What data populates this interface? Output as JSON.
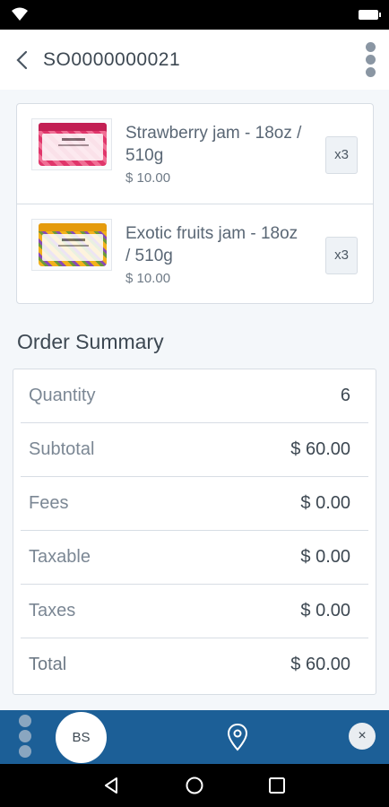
{
  "header": {
    "title": "SO0000000021"
  },
  "order_lines": [
    {
      "name": "Strawberry jam - 18oz / 510g",
      "price": "$ 10.00",
      "quantity": "x3"
    },
    {
      "name": "Exotic fruits jam - 18oz / 510g",
      "price": "$ 10.00",
      "quantity": "x3"
    }
  ],
  "summary": {
    "title": "Order Summary",
    "rows": [
      {
        "label": "Quantity",
        "value": "6"
      },
      {
        "label": "Subtotal",
        "value": "$ 60.00"
      },
      {
        "label": "Fees",
        "value": "$ 0.00"
      },
      {
        "label": "Taxable",
        "value": "$ 0.00"
      },
      {
        "label": "Taxes",
        "value": "$ 0.00"
      },
      {
        "label": "Total",
        "value": "$ 60.00"
      }
    ]
  },
  "bottom_bar": {
    "avatar_initials": "BS",
    "close_label": "×",
    "background_color": "#1c5f97"
  },
  "icons": {
    "status": [
      "wifi-icon",
      "battery-icon"
    ],
    "header": [
      "back-arrow-icon",
      "more-vertical-icon"
    ],
    "bottom_bar": [
      "drag-handle-icon",
      "location-pin-icon",
      "close-icon"
    ],
    "navigation": [
      "nav-back-icon",
      "nav-home-icon",
      "nav-recent-icon"
    ]
  }
}
